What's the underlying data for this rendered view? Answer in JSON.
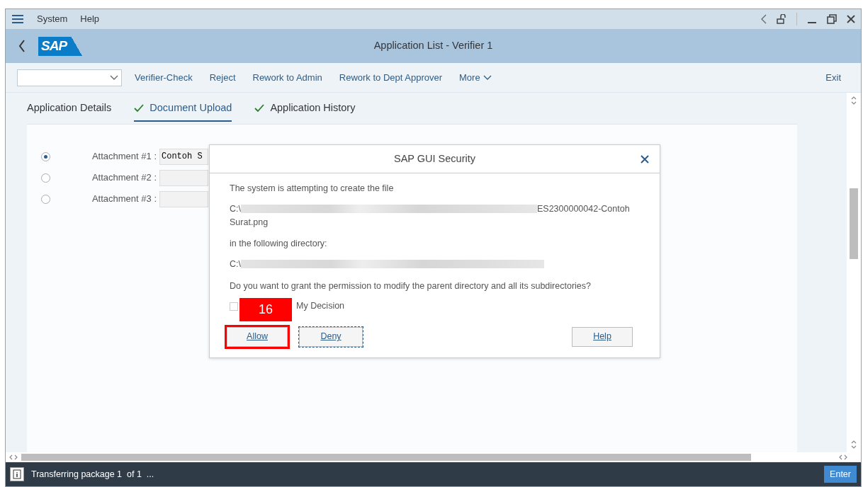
{
  "menu_bar": {
    "items": [
      "System",
      "Help"
    ]
  },
  "header": {
    "logo": "SAP",
    "title": "Application List - Verifier 1"
  },
  "toolbar": {
    "buttons": [
      "Verifier-Check",
      "Reject",
      "Rework to Admin",
      "Rework to Dept Approver",
      "More"
    ],
    "exit": "Exit"
  },
  "tabs": [
    {
      "label": "Application Details",
      "checked": false,
      "selected": false
    },
    {
      "label": "Document Upload",
      "checked": true,
      "selected": true
    },
    {
      "label": "Application History",
      "checked": true,
      "selected": false
    }
  ],
  "attachments": [
    {
      "label": "Attachment #1 :",
      "value": "Contoh S",
      "selected": true
    },
    {
      "label": "Attachment #2 :",
      "selected": false
    },
    {
      "label": "Attachment #3 :",
      "selected": false
    }
  ],
  "dialog": {
    "title": "SAP GUI Security",
    "intro": "The system is attempting to create the file",
    "file_prefix": "C:\\",
    "file_end": "ES2300000042-Contoh",
    "file_continued": "Surat.png",
    "directory_label": "in the following directory:",
    "directory_prefix": "C:\\",
    "question": "Do you want to grant the permission to modify the parent directory and all its subdirectories?",
    "remember": {
      "label": "My Decision",
      "checked": false
    },
    "buttons": [
      "Allow",
      "Deny",
      "Help"
    ]
  },
  "annotation": {
    "label": "16"
  },
  "status_bar": {
    "message": "Transferring package 1  of 1  ...",
    "button": "Enter"
  }
}
